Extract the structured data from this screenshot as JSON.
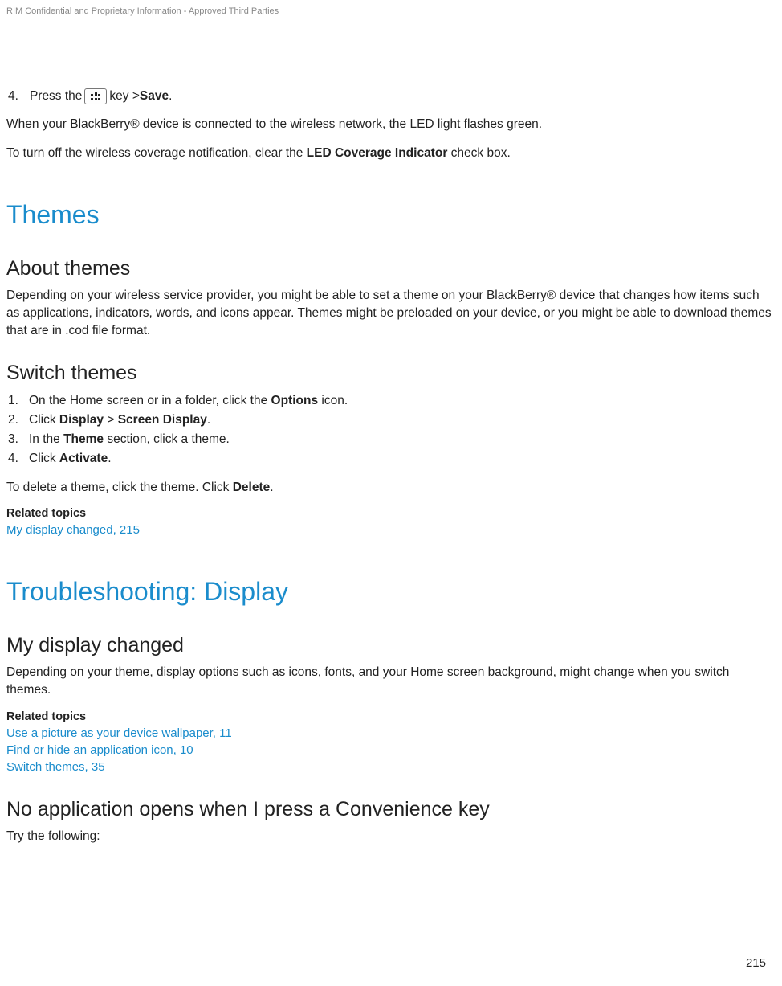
{
  "header_note": "RIM Confidential and Proprietary Information - Approved Third Parties",
  "step4": {
    "num": "4.",
    "prefix": "Press the ",
    "middle": " key > ",
    "save": "Save",
    "suffix": "."
  },
  "para1_pre": "When your BlackBerry® device is connected to the wireless network, the LED light flashes green.",
  "para2_pre": "To turn off the wireless coverage notification, clear the ",
  "para2_bold": "LED Coverage Indicator",
  "para2_post": " check box.",
  "h1_themes": "Themes",
  "h2_about": "About themes",
  "about_para": "Depending on your wireless service provider, you might be able to set a theme on your BlackBerry® device that changes how items such as applications, indicators, words, and icons appear. Themes might be preloaded on your device, or you might be able to download themes that are in .cod file format.",
  "h2_switch": "Switch themes",
  "switch_steps": [
    {
      "num": "1.",
      "pre": "On the Home screen or in a folder, click the ",
      "b1": "Options",
      "post": " icon."
    },
    {
      "num": "2.",
      "pre": "Click ",
      "b1": "Display",
      "mid": " > ",
      "b2": "Screen Display",
      "post": "."
    },
    {
      "num": "3.",
      "pre": "In the ",
      "b1": "Theme",
      "post": " section, click a theme."
    },
    {
      "num": "4.",
      "pre": "Click ",
      "b1": "Activate",
      "post": "."
    }
  ],
  "delete_para_pre": "To delete a theme, click the theme. Click ",
  "delete_para_bold": "Delete",
  "delete_para_post": ".",
  "related_label": "Related topics",
  "related1": "My display changed, 215",
  "h1_trouble": "Troubleshooting: Display",
  "h2_display_changed": "My display changed",
  "display_changed_para": "Depending on your theme, display options such as icons, fonts, and your Home screen background, might change when you switch themes.",
  "related2_items": [
    "Use a picture as your device wallpaper, 11",
    "Find or hide an application icon, 10",
    "Switch themes, 35"
  ],
  "h2_convenience": "No application opens when I press a Convenience key",
  "try_para": "Try the following:",
  "page_number": "215"
}
